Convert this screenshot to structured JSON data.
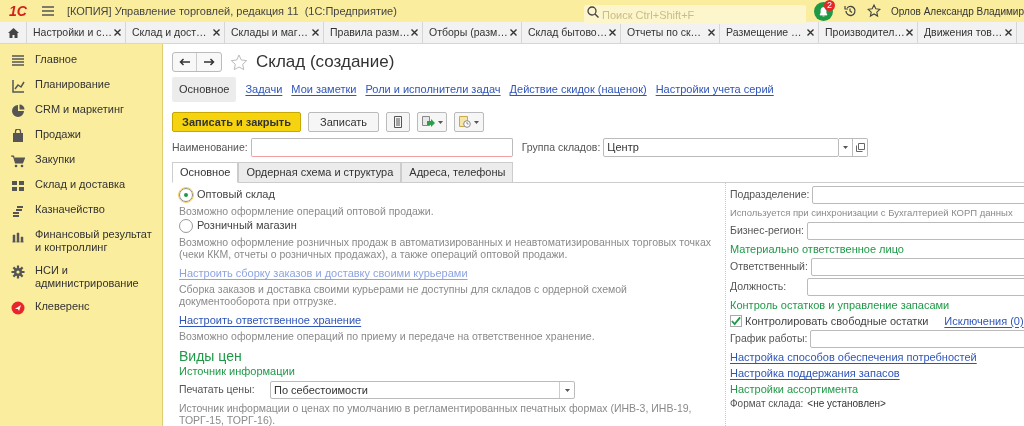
{
  "app_bar": {
    "logo": "1С",
    "title": "[КОПИЯ] Управление торговлей, редакция 11  (1С:Предприятие)",
    "search": {
      "placeholder": "Поиск Ctrl+Shift+F"
    },
    "notification_count": "2",
    "user": "Орлов Александр Владимир"
  },
  "open_tabs": [
    {
      "label": "Настройки и с…"
    },
    {
      "label": "Склад и дост…"
    },
    {
      "label": "Склады и маг…"
    },
    {
      "label": "Правила разм…"
    },
    {
      "label": "Отборы (разм…"
    },
    {
      "label": "Склад бытово…"
    },
    {
      "label": "Отчеты по ск…"
    },
    {
      "label": "Размещение …"
    },
    {
      "label": "Производител…"
    },
    {
      "label": "Движения тов…"
    }
  ],
  "sidebar": {
    "items": [
      {
        "label": "Главное"
      },
      {
        "label": "Планирование"
      },
      {
        "label": "CRM и маркетинг"
      },
      {
        "label": "Продажи"
      },
      {
        "label": "Закупки"
      },
      {
        "label": "Склад и доставка"
      },
      {
        "label": "Казначейство"
      },
      {
        "label": "Финансовый результат и контроллинг"
      },
      {
        "label": "НСИ и администрирование"
      },
      {
        "label": "Клеверенс"
      }
    ]
  },
  "form": {
    "title": "Склад (создание)",
    "nav_tabs": [
      {
        "label": "Основное",
        "selected": true
      },
      {
        "label": "Задачи",
        "selected": false
      },
      {
        "label": "Мои заметки",
        "selected": false
      },
      {
        "label": "Роли и исполнители задач",
        "selected": false
      },
      {
        "label": "Действие скидок (наценок)",
        "selected": false
      },
      {
        "label": "Настройки учета серий",
        "selected": false
      }
    ],
    "toolbar": {
      "save_and_close": "Записать и закрыть",
      "save": "Записать"
    },
    "name_field": {
      "label": "Наименование:"
    },
    "group_field": {
      "label": "Группа складов:",
      "value": "Центр"
    },
    "inner_tabs": [
      {
        "label": "Основное",
        "selected": true
      },
      {
        "label": "Ордерная схема и структура",
        "selected": false
      },
      {
        "label": "Адреса, телефоны",
        "selected": false
      }
    ],
    "left": [
      {
        "kind": "radio",
        "label": "Оптовый склад",
        "selected": true
      },
      {
        "kind": "hint",
        "text": "Возможно оформление операций оптовой продажи."
      },
      {
        "kind": "radio",
        "label": "Розничный магазин",
        "selected": false
      },
      {
        "kind": "hint",
        "text": "Возможно оформление розничных продаж в автоматизированных и неавтоматизированных торговых точках (чеки ККМ, отчеты о розничных продажах), а также операций оптовой продажи."
      },
      {
        "kind": "link",
        "text": "Настроить сборку заказов и доставку своими курьерами",
        "disabled": true
      },
      {
        "kind": "hint",
        "text": "Сборка заказов и доставка своими курьерами не доступны для складов с ордерной схемой документооборота при отгрузке."
      },
      {
        "kind": "link",
        "text": "Настроить ответственное хранение",
        "disabled": false
      },
      {
        "kind": "hint",
        "text": "Возможно оформление операций по приему и передаче на ответственное хранение."
      },
      {
        "kind": "heading",
        "text": "Виды цен"
      },
      {
        "kind": "subheading",
        "text": "Источник информации"
      },
      {
        "kind": "select",
        "label": "Печатать цены:",
        "value": "По себестоимости"
      },
      {
        "kind": "hint",
        "text": "Источник информации о ценах по умолчанию в регламентированных печатных формах (ИНВ-3, ИНВ-19, ТОРГ-15, ТОРГ-16)."
      }
    ],
    "right": [
      {
        "kind": "field",
        "label": "Подразделение:"
      },
      {
        "kind": "hint",
        "text": "Используется при синхронизации с Бухгалтерией КОРП данных"
      },
      {
        "kind": "field",
        "label": "Бизнес-регион:"
      },
      {
        "kind": "subheading",
        "text": "Материально ответственное лицо"
      },
      {
        "kind": "field",
        "label": "Ответственный:"
      },
      {
        "kind": "field",
        "label": "Должность:"
      },
      {
        "kind": "subheading",
        "text": "Контроль остатков и управление запасами"
      },
      {
        "kind": "checkbox",
        "label": "Контролировать свободные остатки",
        "checked": true,
        "link": "Исключения (0)"
      },
      {
        "kind": "field",
        "label": "График работы:"
      },
      {
        "kind": "link",
        "text": "Настройка способов обеспечения потребностей",
        "disabled": false
      },
      {
        "kind": "link",
        "text": "Настройка поддержания запасов",
        "disabled": false
      },
      {
        "kind": "subheading",
        "text": "Настройки ассортимента"
      },
      {
        "kind": "pair",
        "label": "Формат склада:",
        "value": "<не установлен>"
      }
    ]
  }
}
